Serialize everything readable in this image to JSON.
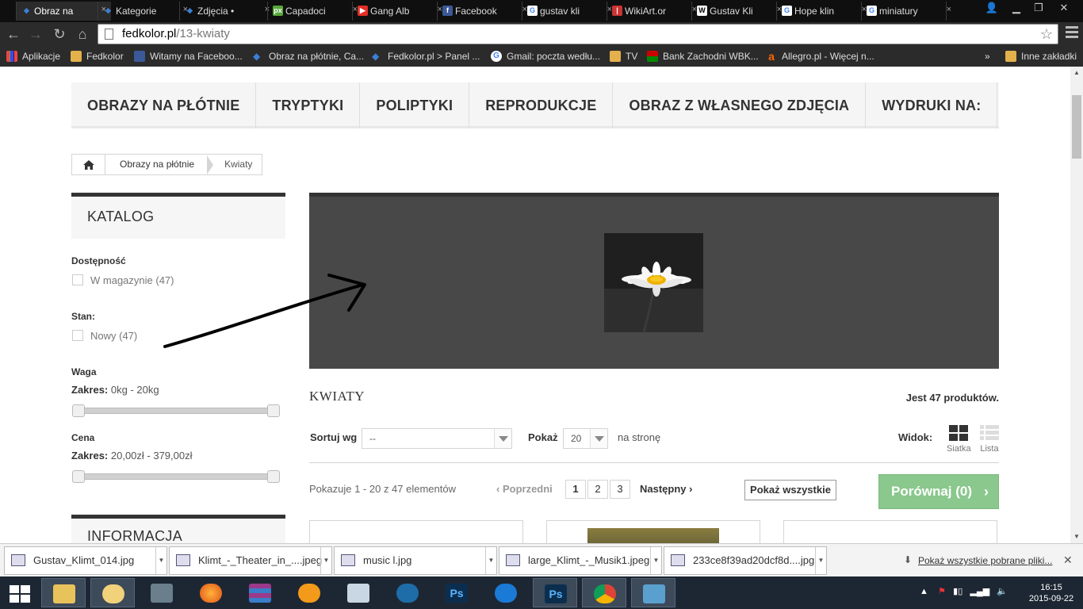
{
  "browser": {
    "tabs": [
      {
        "label": "Obraz na",
        "icon": "diamond-icon",
        "active": true
      },
      {
        "label": "Kategorie",
        "icon": "diamond-icon"
      },
      {
        "label": "Zdjęcia • ",
        "icon": "diamond-icon"
      },
      {
        "label": "Capadoci",
        "icon": "px-icon"
      },
      {
        "label": "Gang Alb",
        "icon": "youtube-icon"
      },
      {
        "label": "Facebook",
        "icon": "facebook-icon"
      },
      {
        "label": "gustav kli",
        "icon": "google-icon"
      },
      {
        "label": "WikiArt.or",
        "icon": "wikiart-icon"
      },
      {
        "label": "Gustav Kli",
        "icon": "wikipedia-icon"
      },
      {
        "label": "Hope klin",
        "icon": "google-icon"
      },
      {
        "label": "miniatury",
        "icon": "google-icon"
      }
    ],
    "url_host": "fedkolor.pl",
    "url_path": "/13-kwiaty",
    "bookmarks": [
      {
        "label": "Aplikacje",
        "icon": "apps-icon"
      },
      {
        "label": "Fedkolor",
        "icon": "folder-icon"
      },
      {
        "label": "Witamy na Faceboo...",
        "icon": "facebook-icon"
      },
      {
        "label": "Obraz na płótnie, Ca...",
        "icon": "diamond-icon"
      },
      {
        "label": "Fedkolor.pl > Panel ...",
        "icon": "diamond-icon"
      },
      {
        "label": "Gmail: poczta wedłu...",
        "icon": "google-icon"
      },
      {
        "label": "TV",
        "icon": "folder-icon"
      },
      {
        "label": "Bank Zachodni WBK...",
        "icon": "bank-icon"
      },
      {
        "label": "Allegro.pl - Więcej n...",
        "icon": "allegro-icon"
      }
    ],
    "bookmarks_more": "»",
    "other_bookmarks": "Inne zakładki"
  },
  "site": {
    "nav": [
      "OBRAZY NA PŁÓTNIE",
      "TRYPTYKI",
      "POLIPTYKI",
      "REPRODUKCJE",
      "OBRAZ Z WŁASNEGO ZDJĘCIA",
      "WYDRUKI NA:"
    ],
    "breadcrumb": [
      "Obrazy na płótnie",
      "Kwiaty"
    ],
    "sidebar": {
      "catalog_title": "KATALOG",
      "availability_label": "Dostępność",
      "availability_option": "W magazynie (47)",
      "condition_label": "Stan:",
      "condition_option": "Nowy (47)",
      "weight_label": "Waga",
      "weight_range_label": "Zakres:",
      "weight_range": "0kg - 20kg",
      "price_label": "Cena",
      "price_range_label": "Zakres:",
      "price_range": "20,00zł - 379,00zł",
      "info_title": "INFORMACJA"
    },
    "category_title": "KWIATY",
    "product_count": "Jest 47 produktów.",
    "sort_label": "Sortuj wg",
    "sort_value": "--",
    "show_label": "Pokaż",
    "show_value": "20",
    "per_page": "na stronę",
    "view_label": "Widok:",
    "view_grid": "Siatka",
    "view_list": "Lista",
    "showing": "Pokazuje 1 - 20 z 47 elementów",
    "prev": "Poprzedni",
    "pages": [
      "1",
      "2",
      "3"
    ],
    "next": "Następny",
    "show_all": "Pokaż wszystkie",
    "compare": "Porównaj (0)"
  },
  "downloads": {
    "items": [
      "Gustav_Klimt_014.jpg",
      "Klimt_-_Theater_in_....jpeg",
      "music l.jpg",
      "large_Klimt_-_Musik1.jpeg",
      "233ce8f39ad20dcf8d....jpg"
    ],
    "show_all": "Pokaż wszystkie pobrane pliki..."
  },
  "taskbar": {
    "time": "16:15",
    "date": "2015-09-22"
  },
  "colors": {
    "compare_button": "#8ac88d",
    "banner_bg": "#484848",
    "chrome_dark": "#2b2b2b"
  }
}
